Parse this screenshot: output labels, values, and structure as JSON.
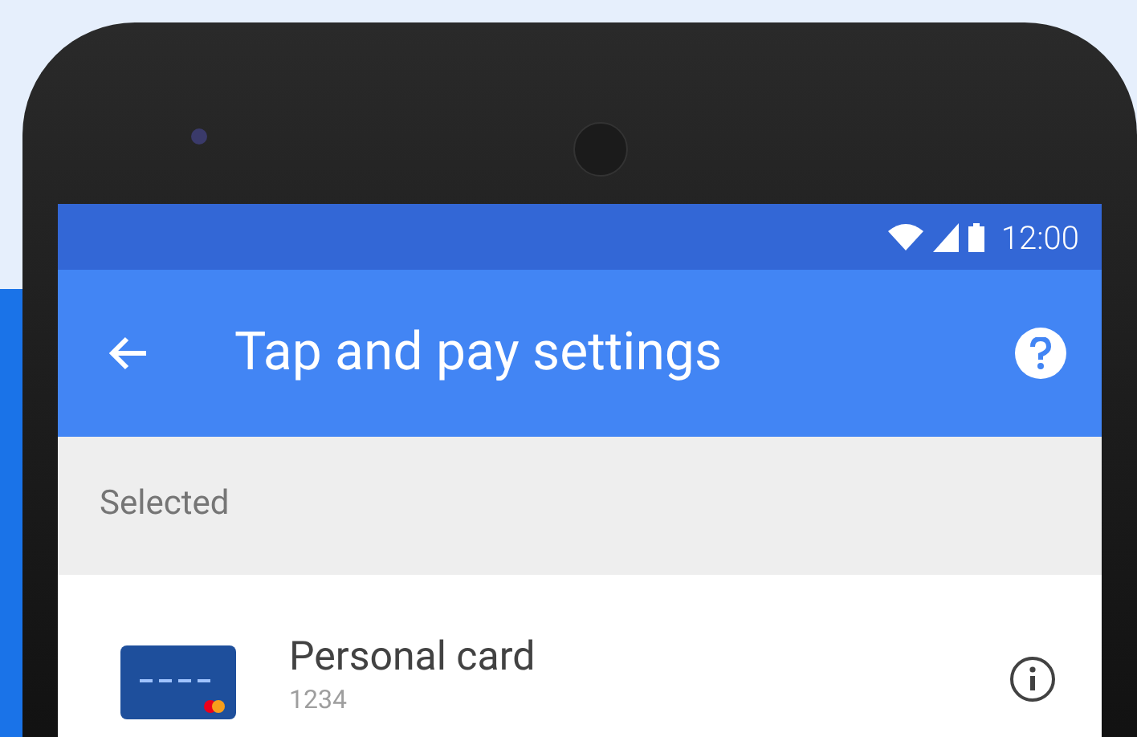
{
  "status_bar": {
    "time": "12:00"
  },
  "toolbar": {
    "title": "Tap and pay settings"
  },
  "section": {
    "header": "Selected"
  },
  "cards": [
    {
      "name": "Personal card",
      "number": "1234"
    }
  ]
}
